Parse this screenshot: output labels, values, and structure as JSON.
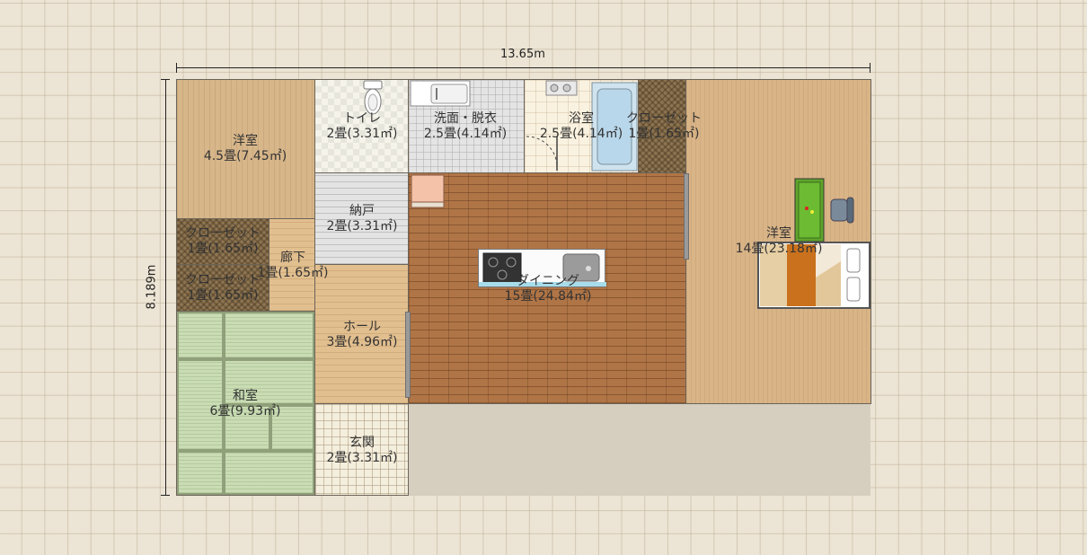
{
  "dimensions": {
    "width_label": "13.65m",
    "height_label": "8.189m"
  },
  "rooms": {
    "western_nw": {
      "name": "洋室",
      "size": "4.5畳(7.45㎡)"
    },
    "toilet": {
      "name": "トイレ",
      "size": "2畳(3.31㎡)"
    },
    "washroom": {
      "name": "洗面・脱衣",
      "size": "2.5畳(4.14㎡)"
    },
    "bath": {
      "name": "浴室",
      "size": "2.5畳(4.14㎡)"
    },
    "closet_top": {
      "name": "クローゼット",
      "size": "1畳(1.65㎡)"
    },
    "western_e": {
      "name": "洋室",
      "size": "14畳(23.18㎡)"
    },
    "storage": {
      "name": "納戸",
      "size": "2畳(3.31㎡)"
    },
    "closet_1": {
      "name": "クローゼット",
      "size": "1畳(1.65㎡)"
    },
    "closet_2": {
      "name": "クローゼット",
      "size": "1畳(1.65㎡)"
    },
    "corridor": {
      "name": "廊下",
      "size": "1畳(1.65㎡)"
    },
    "dining": {
      "name": "ダイニング",
      "size": "15畳(24.84㎡)"
    },
    "hall": {
      "name": "ホール",
      "size": "3畳(4.96㎡)"
    },
    "washitsu": {
      "name": "和室",
      "size": "6畳(9.93㎡)"
    },
    "entrance": {
      "name": "玄関",
      "size": "2畳(3.31㎡)"
    }
  },
  "colors": {
    "background": "#ece4d4",
    "tatami": "#c9dcb4",
    "brick_floor": "#b07546",
    "wood_floor": "#d9b487"
  },
  "icons": [
    "toilet-icon",
    "sink-icon",
    "bathtub-icon",
    "stove-icon",
    "kitchen-sink-icon",
    "desk-icon",
    "chair-icon",
    "bed-icon",
    "shoe-cabinet-icon"
  ]
}
